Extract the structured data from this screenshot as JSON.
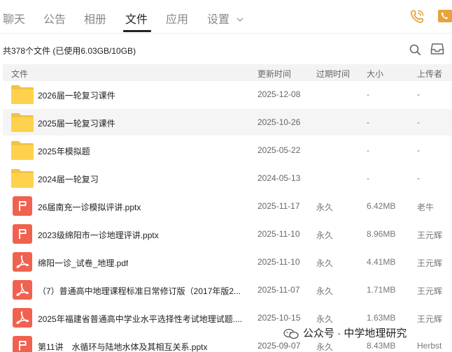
{
  "tabs": [
    {
      "label": "聊天"
    },
    {
      "label": "公告"
    },
    {
      "label": "相册"
    },
    {
      "label": "文件",
      "active": true
    },
    {
      "label": "应用"
    },
    {
      "label": "设置"
    }
  ],
  "summary": "共378个文件 (已使用6.03GB/10GB)",
  "columns": {
    "name": "文件",
    "updated": "更新时间",
    "validity": "过期时间",
    "size": "大小",
    "uploader": "上传者"
  },
  "files": [
    {
      "type": "folder",
      "name": "2026届一轮复习课件",
      "updated": "2025-12-08",
      "validity": "",
      "size": "-",
      "uploader": "-"
    },
    {
      "type": "folder",
      "name": "2025届一轮复习课件",
      "updated": "2025-10-26",
      "validity": "",
      "size": "-",
      "uploader": "-"
    },
    {
      "type": "folder",
      "name": "2025年模拟题",
      "updated": "2025-05-22",
      "validity": "",
      "size": "-",
      "uploader": "-"
    },
    {
      "type": "folder",
      "name": "2024届一轮复习",
      "updated": "2024-05-13",
      "validity": "",
      "size": "-",
      "uploader": "-"
    },
    {
      "type": "pptx",
      "name": "26届南充一诊模拟评讲.pptx",
      "updated": "2025-11-17",
      "validity": "永久",
      "size": "6.42MB",
      "uploader": "老牛"
    },
    {
      "type": "pptx",
      "name": "2023级绵阳市一诊地理评讲.pptx",
      "updated": "2025-11-10",
      "validity": "永久",
      "size": "8.96MB",
      "uploader": "王元辉"
    },
    {
      "type": "pdf",
      "name": "绵阳一诊_试卷_地理.pdf",
      "updated": "2025-11-10",
      "validity": "永久",
      "size": "4.41MB",
      "uploader": "王元辉"
    },
    {
      "type": "pdf",
      "name": "（7）普通高中地理课程标准日常修订版（2017年版2...",
      "updated": "2025-11-07",
      "validity": "永久",
      "size": "1.71MB",
      "uploader": "王元辉"
    },
    {
      "type": "pdf",
      "name": "2025年福建省普通高中学业水平选择性考试地理试题....",
      "updated": "2025-10-15",
      "validity": "永久",
      "size": "1.63MB",
      "uploader": "王元辉"
    },
    {
      "type": "pptx",
      "name": "第11讲　水循环与陆地水体及其相互关系.pptx",
      "updated": "2025-09-07",
      "validity": "永久",
      "size": "8.43MB",
      "uploader": "Herbst"
    }
  ],
  "watermark": "公众号 · 中学地理研究",
  "colors": {
    "accent": "#e8a33d",
    "folder": "#ffd24d",
    "file_red": "#f0624f",
    "text": "#222222",
    "muted": "#888888"
  }
}
